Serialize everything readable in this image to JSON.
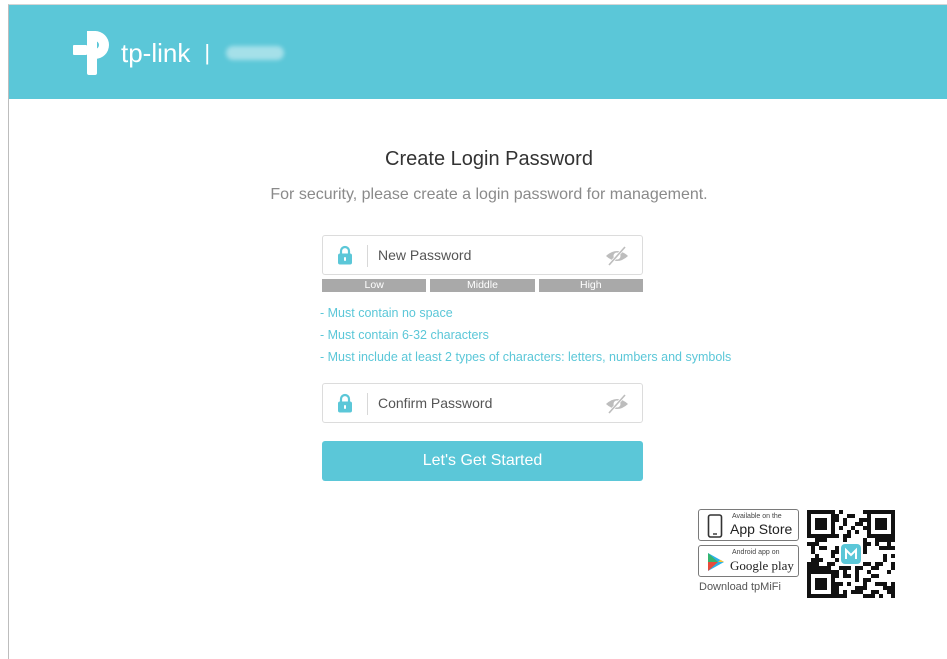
{
  "header": {
    "brand": "tp-link",
    "separator": "|",
    "colors": {
      "header_bg": "#5bc7d8",
      "accent": "#5bc7d8"
    }
  },
  "main": {
    "title": "Create Login Password",
    "subtitle": "For security, please create a login password for management.",
    "new_password": {
      "placeholder": "New Password",
      "value": ""
    },
    "strength": [
      "Low",
      "Middle",
      "High"
    ],
    "rules": [
      "- Must contain no space",
      "- Must contain 6-32 characters",
      "- Must include at least 2 types of characters: letters, numbers and symbols"
    ],
    "confirm_password": {
      "placeholder": "Confirm Password",
      "value": ""
    },
    "start_button": "Let's Get Started"
  },
  "app_promo": {
    "app_store": {
      "small": "Available on the",
      "big": "App Store"
    },
    "google_play": {
      "small": "Android app on",
      "big": "Google play"
    },
    "download_label": "Download tpMiFi"
  },
  "icons": [
    "tp-link-logo-icon",
    "lock-icon",
    "eye-hidden-icon",
    "phone-icon",
    "play-icon",
    "qr-code-icon"
  ]
}
